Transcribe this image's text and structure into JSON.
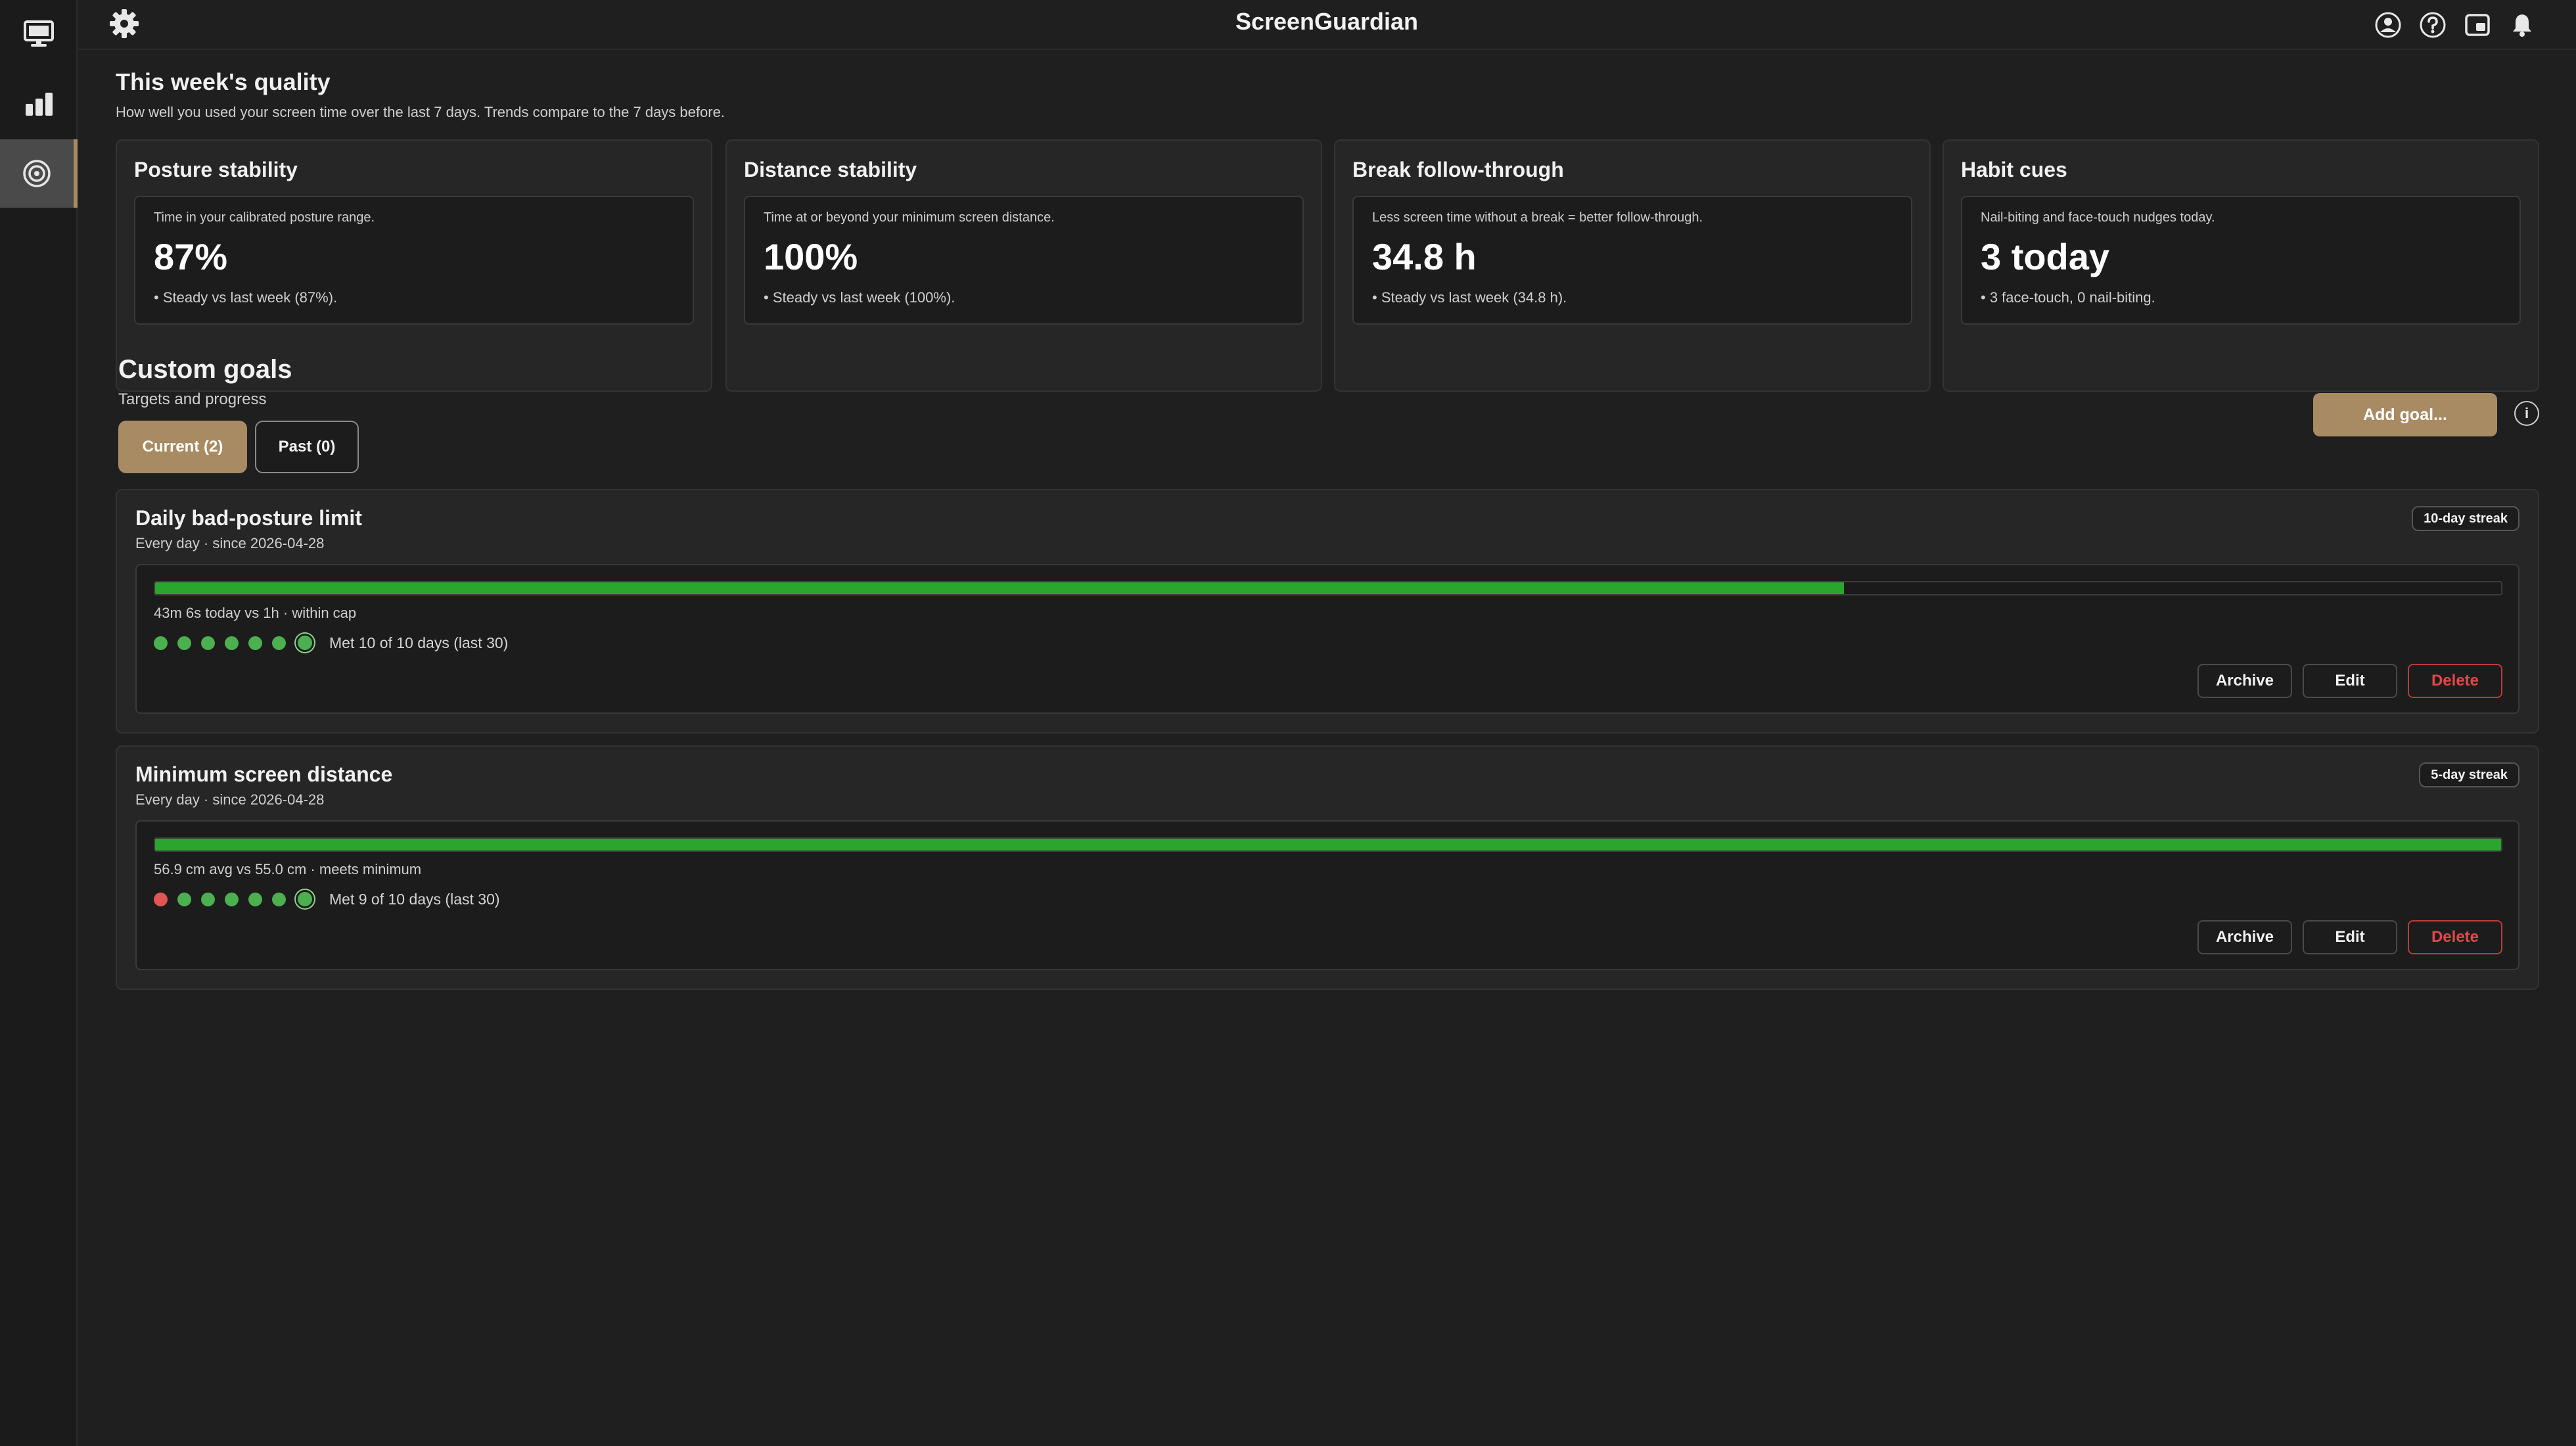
{
  "app": {
    "title": "ScreenGuardian"
  },
  "rail": {
    "items": [
      {
        "icon": "monitor-icon",
        "active": false
      },
      {
        "icon": "bar-chart-icon",
        "active": false
      },
      {
        "icon": "target-icon",
        "active": true
      }
    ]
  },
  "topbar": {
    "icons": [
      "account-icon",
      "help-icon",
      "picture-in-picture-icon",
      "bell-icon"
    ]
  },
  "quality": {
    "title": "This week's quality",
    "subtitle": "How well you used your screen time over the last 7 days. Trends compare to the 7 days before.",
    "cards": [
      {
        "title": "Posture stability",
        "desc": "Time in your calibrated posture range.",
        "value": "87%",
        "note": "• Steady vs last week (87%)."
      },
      {
        "title": "Distance stability",
        "desc": "Time at or beyond your minimum screen distance.",
        "value": "100%",
        "note": "• Steady vs last week (100%)."
      },
      {
        "title": "Break follow-through",
        "desc": "Less screen time without a break = better follow-through.",
        "value": "34.8 h",
        "note": "• Steady vs last week (34.8 h)."
      },
      {
        "title": "Habit cues",
        "desc": "Nail-biting and face-touch nudges today.",
        "value": "3 today",
        "note": "• 3 face-touch, 0 nail-biting."
      }
    ]
  },
  "goals": {
    "title": "Custom goals",
    "subtitle": "Targets and progress",
    "tabs": {
      "current": "Current (2)",
      "past": "Past (0)"
    },
    "add_label": "Add goal...",
    "info_label": "i",
    "items": [
      {
        "title": "Daily bad-posture limit",
        "schedule": "Every day · since 2026-04-28",
        "streak": "10-day streak",
        "progress": 0.72,
        "stat": "43m 6s today vs 1h · within cap",
        "days": [
          "met",
          "met",
          "met",
          "met",
          "met",
          "met",
          "today"
        ],
        "met": "Met 10 of 10 days (last 30)",
        "archive": "Archive",
        "edit": "Edit",
        "delete": "Delete"
      },
      {
        "title": "Minimum screen distance",
        "schedule": "Every day · since 2026-04-28",
        "streak": "5-day streak",
        "progress": 1.0,
        "stat": "56.9 cm avg vs 55.0 cm · meets minimum",
        "days": [
          "miss",
          "met",
          "met",
          "met",
          "met",
          "met",
          "today"
        ],
        "met": "Met 9 of 10 days (last 30)",
        "archive": "Archive",
        "edit": "Edit",
        "delete": "Delete"
      }
    ]
  },
  "colors": {
    "accent": "#a88b63",
    "progress": "#2aa52e",
    "danger": "#e04848",
    "miss": "#e25555"
  }
}
